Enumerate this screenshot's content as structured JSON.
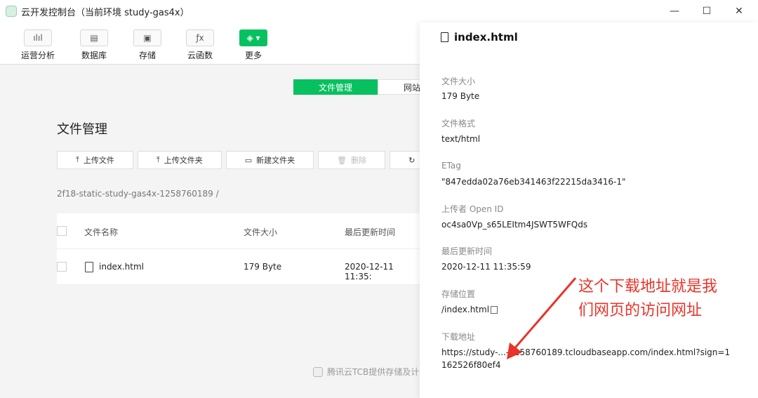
{
  "window": {
    "title": "云开发控制台（当前环境 study-gas4x）",
    "controls": {
      "minimize": "—",
      "maximize": "☐",
      "close": "✕"
    }
  },
  "toolbar": {
    "items": [
      {
        "label": "运营分析",
        "icon": "bar-chart-icon",
        "glyph": "ılıl"
      },
      {
        "label": "数据库",
        "icon": "database-icon",
        "glyph": "▤"
      },
      {
        "label": "存储",
        "icon": "save-icon",
        "glyph": "▣"
      },
      {
        "label": "云函数",
        "icon": "function-icon",
        "glyph": "ƒx"
      },
      {
        "label": "更多",
        "icon": "layers-icon",
        "glyph": "◈ ▾"
      }
    ]
  },
  "tabs": [
    {
      "label": "文件管理",
      "active": true
    },
    {
      "label": "网站",
      "active": false
    }
  ],
  "main": {
    "title": "文件管理",
    "actions": [
      {
        "label": "上传文件",
        "icon": "upload-icon",
        "glyph": "⤒"
      },
      {
        "label": "上传文件夹",
        "icon": "upload-folder-icon",
        "glyph": "⤒"
      },
      {
        "label": "新建文件夹",
        "icon": "new-folder-icon",
        "glyph": "▭"
      },
      {
        "label": "删除",
        "icon": "trash-icon",
        "glyph": "🗑",
        "disabled": true
      },
      {
        "label": "",
        "icon": "refresh-icon",
        "glyph": "↻"
      }
    ],
    "path": "2f18-static-study-gas4x-1258760189 /",
    "table": {
      "headers": [
        "文件名称",
        "文件大小",
        "最后更新时间"
      ],
      "rows": [
        {
          "name": "index.html",
          "size": "179 Byte",
          "updated": "2020-12-11 11:35:"
        }
      ]
    },
    "footer": "腾讯云TCB提供存储及计"
  },
  "panel": {
    "title": "index.html",
    "fields": [
      {
        "label": "文件大小",
        "value": "179 Byte"
      },
      {
        "label": "文件格式",
        "value": "text/html"
      },
      {
        "label": "ETag",
        "value": "\"847edda02a76eb341463f22215da3416-1\""
      },
      {
        "label": "上传者 Open ID",
        "value": "oc4sa0Vp_s65LEItm4JSWT5WFQds"
      },
      {
        "label": "最后更新时间",
        "value": "2020-12-11 11:35:59"
      },
      {
        "label": "存储位置",
        "value": "/index.html"
      },
      {
        "label": "下载地址",
        "value": "https://study-...-1258760189.tcloudbaseapp.com/index.html?sign=1",
        "value2": "162526f80ef4"
      }
    ]
  },
  "annotation": {
    "line1": "这个下载地址就是我",
    "line2": "们网页的访问网址",
    "color": "#e8342a"
  },
  "colors": {
    "accent": "#07c160",
    "annotation": "#e8342a"
  }
}
